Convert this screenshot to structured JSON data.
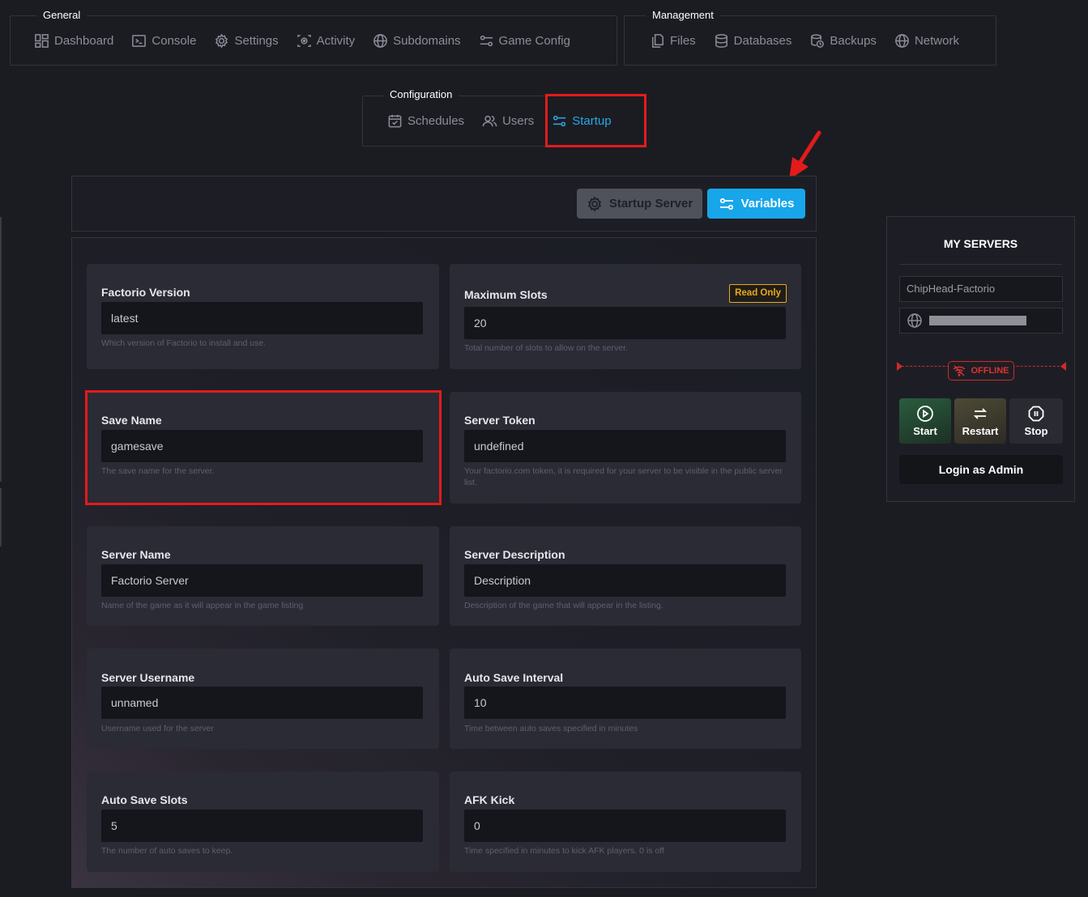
{
  "nav": {
    "general": {
      "legend": "General",
      "items": [
        {
          "label": "Dashboard",
          "icon": "dashboard-icon"
        },
        {
          "label": "Console",
          "icon": "console-icon"
        },
        {
          "label": "Settings",
          "icon": "gear-icon"
        },
        {
          "label": "Activity",
          "icon": "activity-icon"
        },
        {
          "label": "Subdomains",
          "icon": "globe-icon"
        },
        {
          "label": "Game Config",
          "icon": "sliders-icon"
        }
      ]
    },
    "management": {
      "legend": "Management",
      "items": [
        {
          "label": "Files",
          "icon": "files-icon"
        },
        {
          "label": "Databases",
          "icon": "database-icon"
        },
        {
          "label": "Backups",
          "icon": "backups-icon"
        },
        {
          "label": "Network",
          "icon": "globe-icon"
        }
      ]
    },
    "configuration": {
      "legend": "Configuration",
      "items": [
        {
          "label": "Schedules",
          "icon": "calendar-icon"
        },
        {
          "label": "Users",
          "icon": "users-icon"
        },
        {
          "label": "Startup",
          "icon": "sliders-icon",
          "active": true
        }
      ]
    }
  },
  "toolbar": {
    "startup_server_label": "Startup Server",
    "variables_label": "Variables"
  },
  "variables": [
    {
      "label": "Factorio Version",
      "value": "latest",
      "hint": "Which version of Factorio to install and use."
    },
    {
      "label": "Maximum Slots",
      "value": "20",
      "hint": "Total number of slots to allow on the server.",
      "badge": "Read Only"
    },
    {
      "label": "Save Name",
      "value": "gamesave",
      "hint": "The save name for the server."
    },
    {
      "label": "Server Token",
      "value": "undefined",
      "hint": "Your factorio.com token, it is required for your server to be visible in the public server list."
    },
    {
      "label": "Server Name",
      "value": "Factorio Server",
      "hint": "Name of the game as it will appear in the game listing"
    },
    {
      "label": "Server Description",
      "value": "Description",
      "hint": "Description of the game that will appear in the listing."
    },
    {
      "label": "Server Username",
      "value": "unnamed",
      "hint": "Username used for the server"
    },
    {
      "label": "Auto Save Interval",
      "value": "10",
      "hint": "Time between auto saves specified in minutes"
    },
    {
      "label": "Auto Save Slots",
      "value": "5",
      "hint": "The number of auto saves to keep."
    },
    {
      "label": "AFK Kick",
      "value": "0",
      "hint": "Time specified in minutes to kick AFK players. 0 is off"
    }
  ],
  "sidebar": {
    "title": "MY SERVERS",
    "server_name": "ChipHead-Factorio",
    "status": "OFFLINE",
    "start_label": "Start",
    "restart_label": "Restart",
    "stop_label": "Stop",
    "login_label": "Login as Admin"
  },
  "colors": {
    "accent": "#17a6ea",
    "offline": "#e0312f",
    "badge": "#e9a91c",
    "highlight": "#e31b1b"
  }
}
